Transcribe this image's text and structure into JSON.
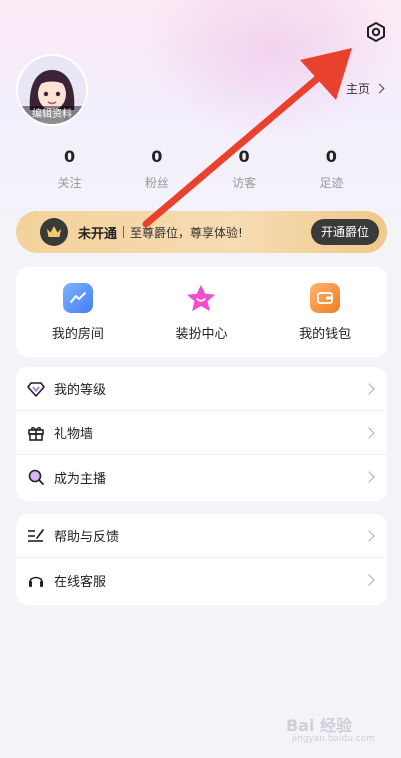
{
  "header": {
    "avatar_label": "编辑资料",
    "homepage_label": "主页"
  },
  "stats": [
    {
      "value": "0",
      "label": "关注"
    },
    {
      "value": "0",
      "label": "粉丝"
    },
    {
      "value": "0",
      "label": "访客"
    },
    {
      "value": "0",
      "label": "足迹"
    }
  ],
  "vip": {
    "status": "未开通",
    "text": "至尊爵位，尊享体验!",
    "button": "开通爵位"
  },
  "quick_actions": [
    {
      "label": "我的房间",
      "icon": "chart-room-icon",
      "color": "#4f8ff7"
    },
    {
      "label": "装扮中心",
      "icon": "star-icon",
      "color": "#f04fcf"
    },
    {
      "label": "我的钱包",
      "icon": "wallet-icon",
      "color": "#f48a2e"
    }
  ],
  "menu_group_1": [
    {
      "label": "我的等级",
      "icon": "diamond-icon"
    },
    {
      "label": "礼物墙",
      "icon": "gift-icon"
    },
    {
      "label": "成为主播",
      "icon": "magnifier-icon"
    }
  ],
  "menu_group_2": [
    {
      "label": "帮助与反馈",
      "icon": "edit-lines-icon"
    },
    {
      "label": "在线客服",
      "icon": "headphones-icon"
    }
  ],
  "watermark": {
    "main": "Bai 经验",
    "sub": "jingyan.baidu.com"
  },
  "colors": {
    "annotation_arrow": "#e8412d",
    "vip_gold": "#f3d29b",
    "vip_dark": "#3a3a3a"
  }
}
